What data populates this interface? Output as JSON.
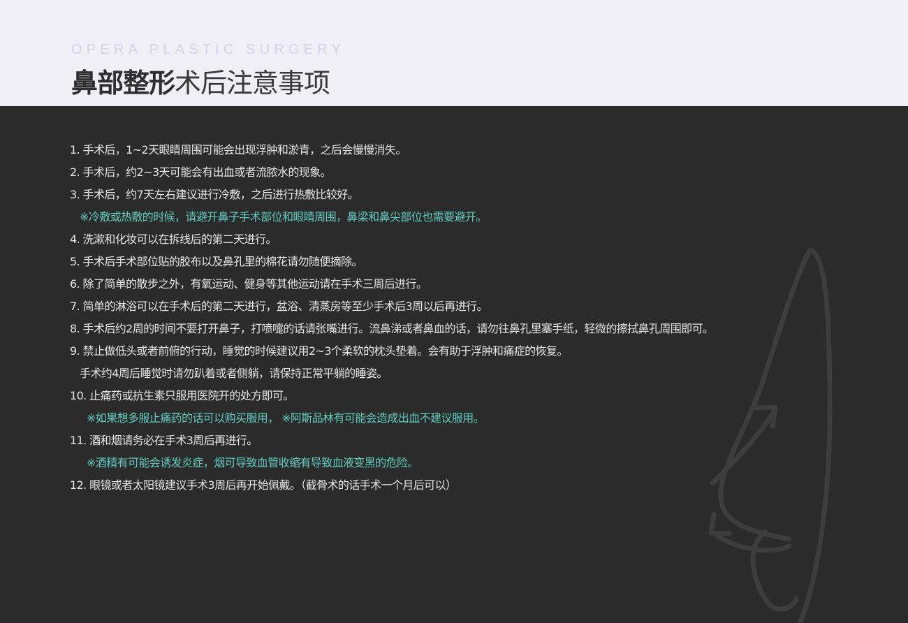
{
  "header": {
    "brand": "OPERA PLASTIC SURGERY",
    "title_bold": "鼻部整形",
    "title_light": "术后注意事项"
  },
  "lines": [
    {
      "text": "1. 手术后，1~2天眼睛周围可能会出现浮肿和淤青，之后会慢慢消失。",
      "kind": "item",
      "indent": 0
    },
    {
      "text": "2. 手术后，约2~3天可能会有出血或者流脓水的现象。",
      "kind": "item",
      "indent": 0
    },
    {
      "text": "3. 手术后，约7天左右建议进行冷敷，之后进行热敷比较好。",
      "kind": "item",
      "indent": 0
    },
    {
      "text": "※冷敷或热敷的时候，请避开鼻子手术部位和眼睛周围，鼻梁和鼻尖部位也需要避开。",
      "kind": "note",
      "indent": 1
    },
    {
      "text": "4. 洗漱和化妆可以在拆线后的第二天进行。",
      "kind": "item",
      "indent": 0
    },
    {
      "text": "5. 手术后手术部位贴的胶布以及鼻孔里的棉花请勿随便摘除。",
      "kind": "item",
      "indent": 0
    },
    {
      "text": "6. 除了简单的散步之外，有氧运动、健身等其他运动请在手术三周后进行。",
      "kind": "item",
      "indent": 0
    },
    {
      "text": "7. 简单的淋浴可以在手术后的第二天进行，盆浴、清蒸房等至少手术后3周以后再进行。",
      "kind": "item",
      "indent": 0
    },
    {
      "text": "8. 手术后约2周的时间不要打开鼻子，打喷嚏的话请张嘴进行。流鼻涕或者鼻血的话，请勿往鼻孔里塞手纸，轻微的擦拭鼻孔周围即可。",
      "kind": "item",
      "indent": 0
    },
    {
      "text": "9. 禁止做低头或者前俯的行动，睡觉的时候建议用2~3个柔软的枕头垫着。会有助于浮肿和痛症的恢复。",
      "kind": "item",
      "indent": 0
    },
    {
      "text": "手术约4周后睡觉时请勿趴着或者侧躺，请保持正常平躺的睡姿。",
      "kind": "item",
      "indent": 1
    },
    {
      "text": "10. 止痛药或抗生素只服用医院开的处方即可。",
      "kind": "item",
      "indent": 0
    },
    {
      "text": "※如果想多服止痛药的话可以购买服用， ※阿斯品林有可能会造成出血不建议服用。",
      "kind": "note",
      "indent": 2
    },
    {
      "text": "11. 酒和烟请务必在手术3周后再进行。",
      "kind": "item",
      "indent": 0
    },
    {
      "text": "※酒精有可能会诱发炎症，烟可导致血管收缩有导致血液变黑的危险。",
      "kind": "note",
      "indent": 2
    },
    {
      "text": "12. 眼镜或者太阳镜建议手术3周后再开始佩戴。（截骨术的话手术一个月后可以）",
      "kind": "item",
      "indent": 0
    }
  ],
  "colors": {
    "header_bg": "#f0eff5",
    "content_bg": "#2b2b2b",
    "text": "#e6e6e6",
    "note": "#5fcdbf",
    "brand": "#d4d3ea"
  },
  "decoration": "nose-outline-illustration"
}
